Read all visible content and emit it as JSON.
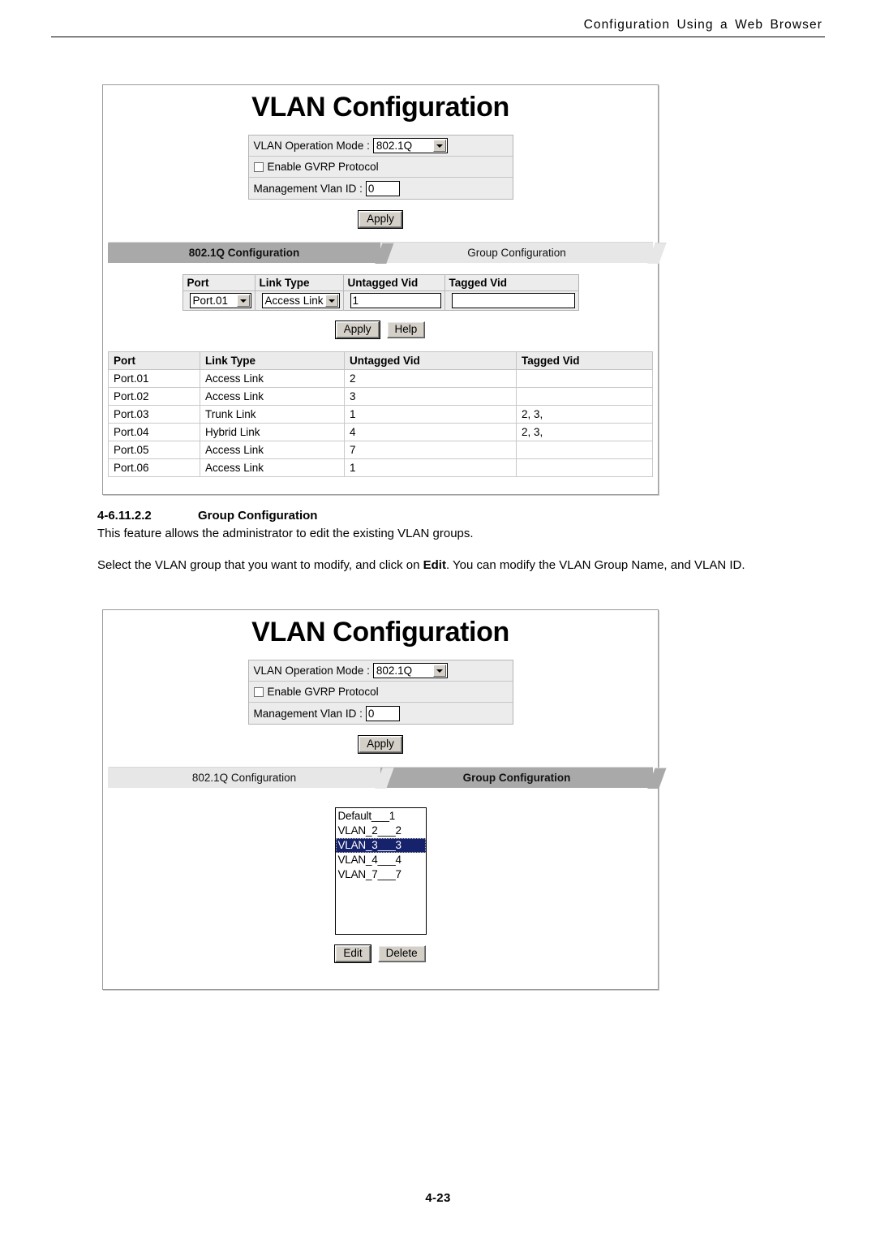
{
  "header": {
    "running_head": "Configuration  Using  a  Web  Browser"
  },
  "footer": {
    "page_number": "4-23"
  },
  "colors": {
    "tab_active_bg": "#a9a9a9",
    "tab_inactive_bg": "#e7e7e7",
    "selection_bg": "#16226b",
    "panel_border": "#9b9b9b",
    "button_face": "#d4d0c8"
  },
  "screenshot_top": {
    "title": "VLAN Configuration",
    "form": {
      "operation_mode_label": "VLAN Operation Mode :",
      "operation_mode_value": "802.1Q",
      "operation_mode_options": [
        "802.1Q"
      ],
      "gvrp_label": "Enable GVRP Protocol",
      "gvrp_checked": false,
      "mgmt_vlan_label": "Management Vlan ID :",
      "mgmt_vlan_value": "0",
      "apply_label": "Apply"
    },
    "tabs": [
      {
        "label": "802.1Q Configuration",
        "active": true
      },
      {
        "label": "Group Configuration",
        "active": false
      }
    ],
    "edit_row": {
      "headers": [
        "Port",
        "Link Type",
        "Untagged Vid",
        "Tagged Vid"
      ],
      "port_value": "Port.01",
      "link_type_value": "Access Link",
      "untagged_vid_value": "1",
      "tagged_vid_value": "",
      "apply_label": "Apply",
      "help_label": "Help"
    },
    "results_table": {
      "headers": [
        "Port",
        "Link Type",
        "Untagged Vid",
        "Tagged Vid"
      ],
      "rows": [
        {
          "port": "Port.01",
          "link_type": "Access Link",
          "untagged_vid": "2",
          "tagged_vid": ""
        },
        {
          "port": "Port.02",
          "link_type": "Access Link",
          "untagged_vid": "3",
          "tagged_vid": ""
        },
        {
          "port": "Port.03",
          "link_type": "Trunk Link",
          "untagged_vid": "1",
          "tagged_vid": "2, 3,"
        },
        {
          "port": "Port.04",
          "link_type": "Hybrid Link",
          "untagged_vid": "4",
          "tagged_vid": "2, 3,"
        },
        {
          "port": "Port.05",
          "link_type": "Access Link",
          "untagged_vid": "7",
          "tagged_vid": ""
        },
        {
          "port": "Port.06",
          "link_type": "Access Link",
          "untagged_vid": "1",
          "tagged_vid": ""
        }
      ]
    }
  },
  "doc_section": {
    "section_number": "4-6.11.2.2",
    "section_title": "Group Configuration",
    "paragraph_1": "This feature allows the administrator to edit the existing VLAN groups.",
    "paragraph_2_part_1": "Select the VLAN group that you want to modify, and click on ",
    "paragraph_2_bold": "Edit",
    "paragraph_2_part_2": ". You can modify the VLAN Group Name, and VLAN ID."
  },
  "screenshot_bottom": {
    "title": "VLAN Configuration",
    "form": {
      "operation_mode_label": "VLAN Operation Mode :",
      "operation_mode_value": "802.1Q",
      "operation_mode_options": [
        "802.1Q"
      ],
      "gvrp_label": "Enable GVRP Protocol",
      "gvrp_checked": false,
      "mgmt_vlan_label": "Management Vlan ID :",
      "mgmt_vlan_value": "0",
      "apply_label": "Apply"
    },
    "tabs": [
      {
        "label": "802.1Q Configuration",
        "active": false
      },
      {
        "label": "Group Configuration",
        "active": true
      }
    ],
    "vlan_group_list": {
      "items": [
        {
          "text": "Default___1",
          "selected": false
        },
        {
          "text": "VLAN_2___2",
          "selected": false
        },
        {
          "text": "VLAN_3___3",
          "selected": true
        },
        {
          "text": "VLAN_4___4",
          "selected": false
        },
        {
          "text": "VLAN_7___7",
          "selected": false
        }
      ]
    },
    "buttons": {
      "edit_label": "Edit",
      "delete_label": "Delete"
    }
  }
}
